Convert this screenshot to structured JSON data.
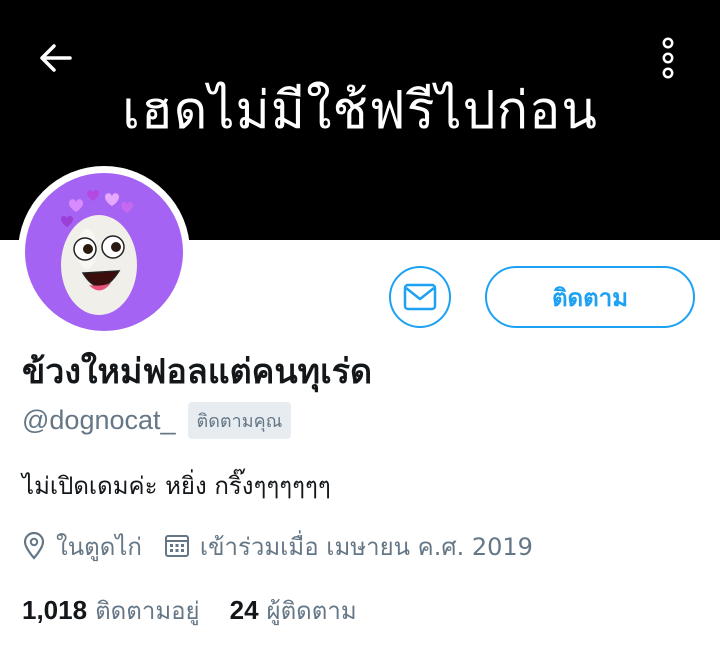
{
  "header": {
    "banner_text": "เฮดไม่มีใช้ฟรีไปก่อน",
    "back_icon": "arrow-left-icon",
    "more_icon": "more-vertical-icon"
  },
  "profile": {
    "avatar_desc": "avatar",
    "display_name": "ข้วงใหม่ฟอลแต่คนทุเร่ด",
    "handle": "@dognocat_",
    "follows_you_badge": "ติดตามคุณ",
    "bio": "ไม่เปิดเดมค่ะ หยิ่ง กริ๊งๆๆๆๆๆๆ",
    "location": "ในตูดไก่",
    "joined": "เข้าร่วมเมื่อ เมษายน ค.ศ. 2019"
  },
  "actions": {
    "follow_label": "ติดตาม",
    "message_icon": "envelope-icon"
  },
  "stats": {
    "following_count": "1,018",
    "following_label": "ติดตามอยู่",
    "followers_count": "24",
    "followers_label": "ผู้ติดตาม"
  },
  "colors": {
    "accent": "#1da1f2",
    "banner_bg": "#000000",
    "avatar_bg": "#a463f2",
    "secondary_text": "#657786"
  }
}
